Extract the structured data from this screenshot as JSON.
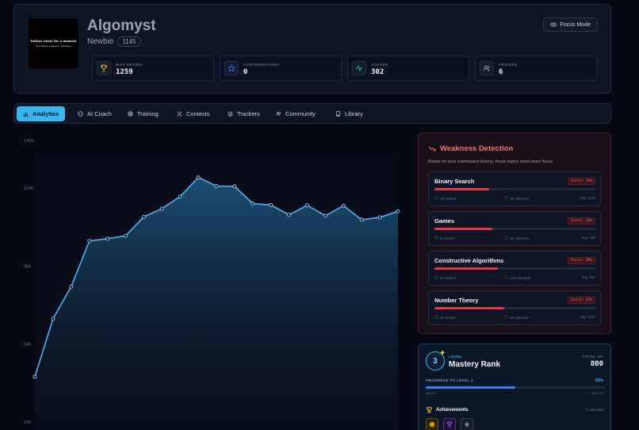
{
  "profile": {
    "avatar_line1": "Failure exists for a moment",
    "avatar_line2": "but regret waits for a lifetime",
    "username": "Algomyst",
    "rank_title": "Newbie",
    "rating": "1145",
    "focus_mode_label": "Focus Mode"
  },
  "stats": [
    {
      "label": "MAX RATING",
      "value": "1259",
      "icon": "trophy-icon",
      "color": "#eab308"
    },
    {
      "label": "CONTRIBUTIONS",
      "value": "0",
      "icon": "star-icon",
      "color": "#3b82f6"
    },
    {
      "label": "SOLVED",
      "value": "302",
      "icon": "activity-icon",
      "color": "#22c55e"
    },
    {
      "label": "FRIENDS",
      "value": "6",
      "icon": "users-icon",
      "color": "#94a3b8"
    }
  ],
  "tabs": [
    {
      "label": "Analytics",
      "icon": "bar-chart-icon",
      "active": true
    },
    {
      "label": "AI Coach",
      "icon": "bot-icon"
    },
    {
      "label": "Training",
      "icon": "target-icon"
    },
    {
      "label": "Contests",
      "icon": "swords-icon"
    },
    {
      "label": "Trackers",
      "icon": "layers-icon"
    },
    {
      "label": "Community",
      "icon": "users-icon"
    },
    {
      "label": "Library",
      "icon": "book-icon"
    }
  ],
  "chart_data": {
    "type": "area",
    "yticks": [
      195,
      545,
      895,
      1245,
      1459
    ],
    "ylim": [
      195,
      1459
    ],
    "values": [
      195,
      456,
      600,
      805,
      815,
      828,
      913,
      950,
      1004,
      1090,
      1051,
      1050,
      973,
      966,
      922,
      965,
      918,
      963,
      900,
      911,
      938
    ],
    "xlabel": "",
    "ylabel": "",
    "grid": false,
    "accent": "#4fb3f0"
  },
  "weakness": {
    "title": "Weakness Detection",
    "subtitle": "Based on your submission history, these topics need more focus.",
    "topics": [
      {
        "name": "Binary Search",
        "score": "Score: 34%",
        "fill": 0.34,
        "solved": "20 Solved",
        "attempts": "39 Attempts",
        "avg": "Avg: 1235"
      },
      {
        "name": "Games",
        "score": "Score: 36%",
        "fill": 0.36,
        "solved": "8 Solved",
        "attempts": "22 Attempts",
        "avg": "Avg: 938"
      },
      {
        "name": "Constructive Algorithms",
        "score": "Score: 39%",
        "fill": 0.39,
        "solved": "52 Solved",
        "attempts": "135 Attempts",
        "avg": "Avg: 992"
      },
      {
        "name": "Number Theory",
        "score": "Score: 43%",
        "fill": 0.43,
        "solved": "29 Solved",
        "attempts": "68 Attempts",
        "avg": "Avg: 1041"
      }
    ]
  },
  "mastery": {
    "level_number": "3",
    "level_label": "LEVEL",
    "rank_name": "Mastery Rank",
    "total_xp_label": "TOTAL XP",
    "total_xp": "800",
    "progress_label": "PROGRESS TO LEVEL 4",
    "progress_pct": "53%",
    "progress_fraction": 0.53,
    "xp_from": "800 XP",
    "xp_to": "1500 XP",
    "achievements_label": "Achievements",
    "achievements_count": "3 Unlocked",
    "badges": [
      {
        "icon": "coin-icon",
        "color": "#eab308"
      },
      {
        "icon": "trophy-icon",
        "color": "#a855f7"
      },
      {
        "icon": "sparkle-icon",
        "color": "#94a3b8"
      }
    ]
  }
}
